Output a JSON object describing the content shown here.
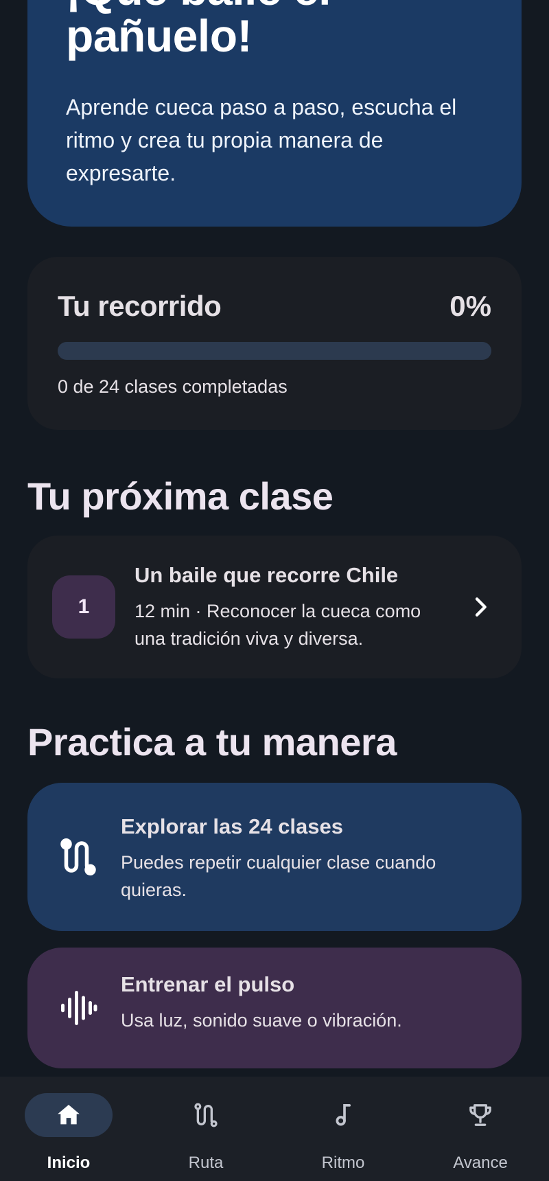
{
  "hero": {
    "title_line1": "¡Que baile el",
    "title_line2": "pañuelo!",
    "description": "Aprende cueca paso a paso, escucha el ritmo y crea tu propia manera de expresarte."
  },
  "progress": {
    "title": "Tu recorrido",
    "percent_label": "0%",
    "fraction": 0,
    "subtitle": "0 de 24 clases completadas"
  },
  "next_class": {
    "section_title": "Tu próxima clase",
    "number": "1",
    "title": "Un baile que recorre Chile",
    "description": "12 min · Reconocer la cueca como una tradición viva y diversa."
  },
  "practice": {
    "section_title": "Practica a tu manera",
    "cards": [
      {
        "title": "Explorar las 24 clases",
        "description": "Puedes repetir cualquier clase cuando quieras.",
        "icon": "route-icon",
        "color": "#1f3a60"
      },
      {
        "title": "Entrenar el pulso",
        "description": "Usa luz, sonido suave o vibración.",
        "icon": "waveform-icon",
        "color": "#3e2d4c"
      }
    ]
  },
  "bottom_nav": {
    "items": [
      {
        "label": "Inicio",
        "icon": "home-icon",
        "active": true
      },
      {
        "label": "Ruta",
        "icon": "route-icon",
        "active": false
      },
      {
        "label": "Ritmo",
        "icon": "music-note-icon",
        "active": false
      },
      {
        "label": "Avance",
        "icon": "trophy-icon",
        "active": false
      }
    ]
  },
  "colors": {
    "background": "#131921",
    "hero": "#1b3a64",
    "card": "#1b1e24",
    "accent_blue": "#a8c8ff",
    "accent_purple": "#3e2d4c"
  }
}
